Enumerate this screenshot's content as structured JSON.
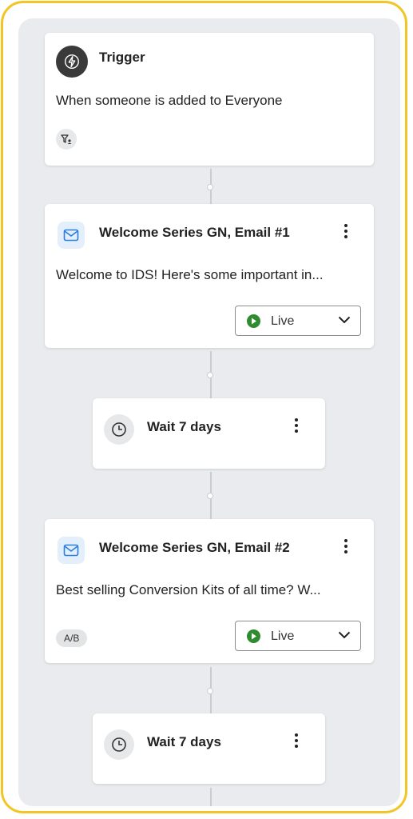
{
  "trigger": {
    "title": "Trigger",
    "description": "When someone is added to Everyone",
    "icon": "lightning-icon",
    "filter_icon": "filter-icon"
  },
  "email1": {
    "title": "Welcome Series GN, Email #1",
    "preview": "Welcome to IDS! Here's some important in...",
    "status": "Live",
    "icon": "mail-icon"
  },
  "wait1": {
    "label": "Wait 7 days",
    "icon": "clock-icon"
  },
  "email2": {
    "title": "Welcome Series GN, Email #2",
    "preview": "Best selling Conversion Kits of all time? W...",
    "badge": "A/B",
    "status": "Live",
    "icon": "mail-icon"
  },
  "wait2": {
    "label": "Wait 7 days",
    "icon": "clock-icon"
  },
  "colors": {
    "frame_border": "#f2c524",
    "canvas_bg": "#e9ebee",
    "live_green": "#2e8b2e",
    "mail_bg": "#e3f0fc"
  }
}
